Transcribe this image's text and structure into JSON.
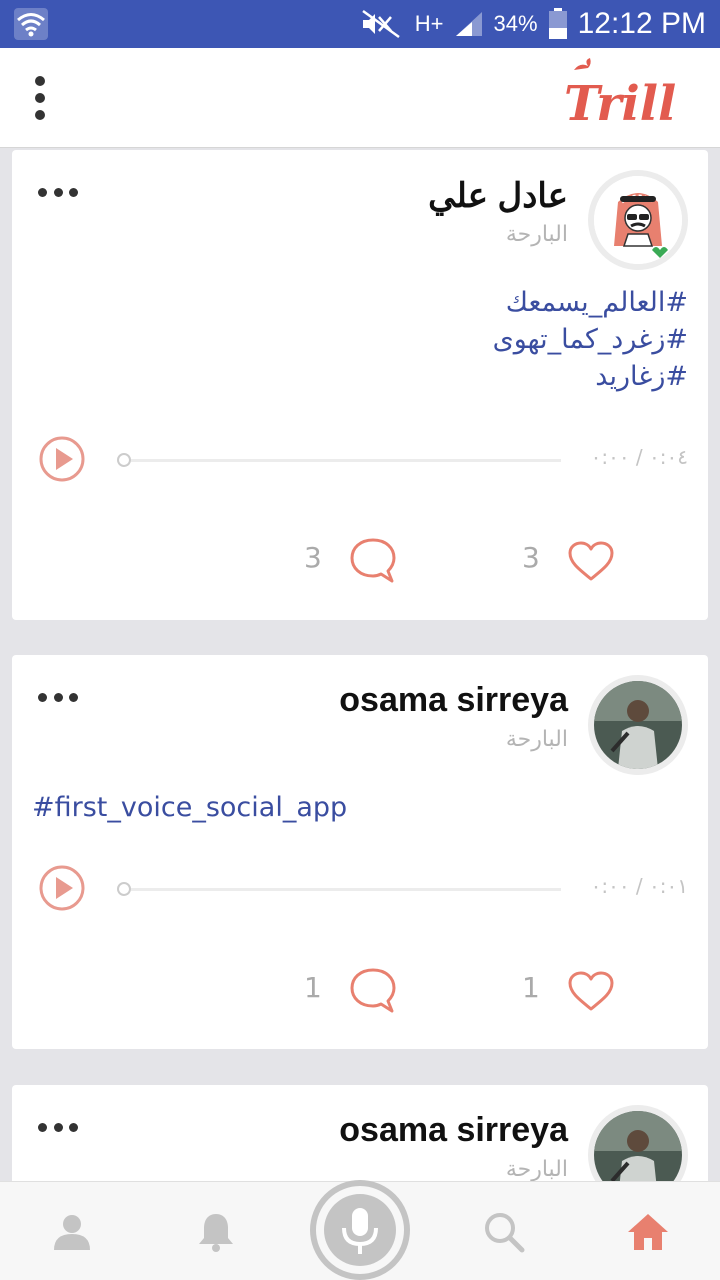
{
  "status_bar": {
    "battery": "34%",
    "network": "H+",
    "time": "12:12 PM"
  },
  "app": {
    "logo_text": "Trill",
    "brand_color": "#e25b4f",
    "accent_color": "#e89a8f",
    "link_color": "#3a4da0"
  },
  "posts": [
    {
      "username": "عادل علي",
      "time_ago": "البارحة",
      "hashtags": [
        "#العالم_يسمعك",
        "#زغرد_كما_تهوى",
        "#زغاريد"
      ],
      "direction": "rtl",
      "duration": "٠:٠٤ / ٠:٠٠",
      "comments": "3",
      "likes": "3",
      "avatar": "cartoon-avatar"
    },
    {
      "username": "osama sirreya",
      "time_ago": "البارحة",
      "hashtags": [
        "#first_voice_social_app"
      ],
      "direction": "ltr",
      "duration": "٠:٠١ / ٠:٠٠",
      "comments": "1",
      "likes": "1",
      "avatar": "photo-avatar"
    },
    {
      "username": "osama sirreya",
      "time_ago": "البارحة",
      "avatar": "photo-avatar"
    }
  ],
  "bottom_nav": {
    "items": [
      "profile-icon",
      "bell-icon",
      "mic-icon",
      "search-icon",
      "home-icon"
    ],
    "active": "home-icon",
    "active_color": "#e8806f",
    "inactive_color": "#c4c4c4"
  }
}
